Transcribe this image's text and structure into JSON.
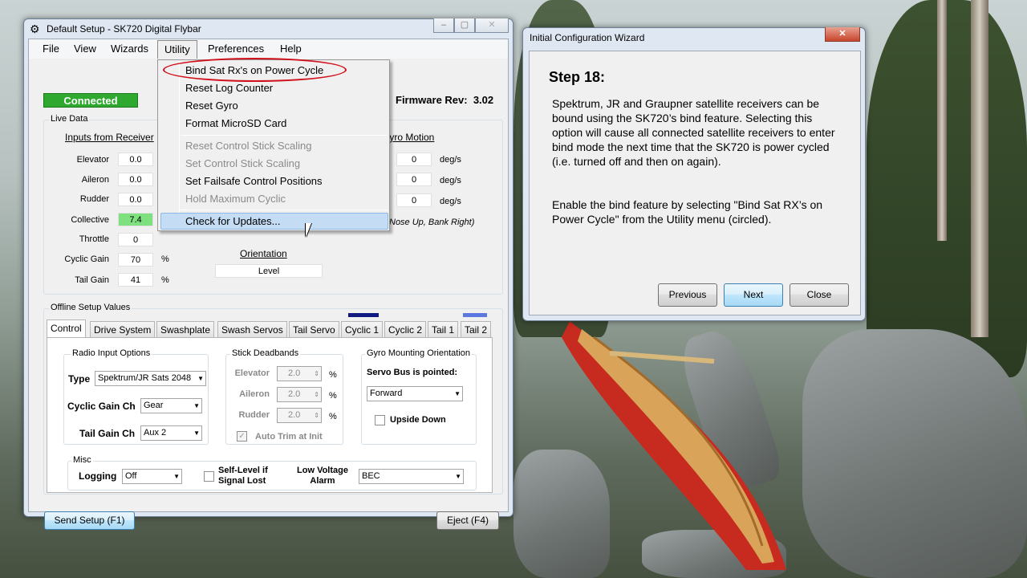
{
  "main_window": {
    "title": "Default Setup - SK720 Digital Flybar",
    "menu": [
      "File",
      "View",
      "Wizards",
      "Utility",
      "Preferences",
      "Help"
    ],
    "status": "Connected",
    "firmware_label": "Firmware Rev:",
    "firmware_value": "3.02",
    "live_data": {
      "group_label": "Live Data",
      "inputs_header": "Inputs from Receiver",
      "gyro_header": "Gyro Motion",
      "inputs": [
        {
          "label": "Elevator",
          "value": "0.0"
        },
        {
          "label": "Aileron",
          "value": "0.0"
        },
        {
          "label": "Rudder",
          "value": "0.0"
        },
        {
          "label": "Collective",
          "value": "7.4"
        },
        {
          "label": "Throttle",
          "value": "0"
        },
        {
          "label": "Cyclic Gain",
          "value": "70",
          "unit": "%"
        },
        {
          "label": "Tail Gain",
          "value": "41",
          "unit": "%"
        }
      ],
      "gyro": [
        {
          "value": "0",
          "unit": "deg/s"
        },
        {
          "value": "0",
          "unit": "deg/s"
        },
        {
          "value": "0",
          "unit": "deg/s"
        }
      ],
      "gyro_note": "Nose Up, Bank Right)",
      "orientation_label": "Orientation",
      "orientation_value": "Level"
    },
    "offline": {
      "group_label": "Offline Setup Values",
      "tabs": [
        "Control",
        "Drive System",
        "Swashplate",
        "Swash Servos",
        "Tail Servo",
        "Cyclic 1",
        "Cyclic 2",
        "Tail 1",
        "Tail 2"
      ],
      "radio": {
        "label": "Radio Input Options",
        "type_label": "Type",
        "type_value": "Spektrum/JR Sats 2048",
        "cyclic_label": "Cyclic Gain Ch",
        "cyclic_value": "Gear",
        "tail_label": "Tail Gain Ch",
        "tail_value": "Aux 2"
      },
      "deadbands": {
        "label": "Stick Deadbands",
        "rows": [
          {
            "label": "Elevator",
            "value": "2.0",
            "unit": "%"
          },
          {
            "label": "Aileron",
            "value": "2.0",
            "unit": "%"
          },
          {
            "label": "Rudder",
            "value": "2.0",
            "unit": "%"
          }
        ],
        "auto_trim": "Auto Trim at Init"
      },
      "gyro_mount": {
        "label": "Gyro Mounting Orientation",
        "servo_bus_label": "Servo Bus is pointed:",
        "servo_bus_value": "Forward",
        "upside_down": "Upside Down"
      },
      "misc": {
        "label": "Misc",
        "logging_label": "Logging",
        "logging_value": "Off",
        "self_level": "Self-Level if Signal Lost",
        "low_voltage_label": "Low Voltage Alarm",
        "low_voltage_value": "BEC"
      }
    },
    "send_button": "Send Setup (F1)",
    "eject_button": "Eject (F4)"
  },
  "utility_menu": {
    "items": [
      {
        "label": "Bind Sat Rx's on Power Cycle",
        "enabled": true
      },
      {
        "label": "Reset Log Counter",
        "enabled": true
      },
      {
        "label": "Reset Gyro",
        "enabled": true
      },
      {
        "label": "Format MicroSD Card",
        "enabled": true
      },
      {
        "label": "Reset Control Stick Scaling",
        "enabled": false
      },
      {
        "label": "Set Control Stick Scaling",
        "enabled": false
      },
      {
        "label": "Set Failsafe Control Positions",
        "enabled": true
      },
      {
        "label": "Hold Maximum Cyclic",
        "enabled": false
      },
      {
        "label": "Check for Updates...",
        "enabled": true
      }
    ]
  },
  "wizard": {
    "title": "Initial Configuration Wizard",
    "step": "Step 18:",
    "para1": "Spektrum, JR and Graupner satellite receivers can be bound using the SK720’s bind feature. Selecting this option will cause all connected satellite receivers to enter bind mode the next time that the SK720 is power cycled (i.e. turned off and then on again).",
    "para2": "Enable the bind feature by selecting \"Bind Sat RX’s on Power Cycle\" from the Utility menu (circled).",
    "previous": "Previous",
    "next": "Next",
    "close": "Close"
  },
  "colors": {
    "connected": "#2ea82e",
    "collective_highlight": "#7ee07e",
    "circle": "#d0101a",
    "selection": "#c4dcf4"
  }
}
